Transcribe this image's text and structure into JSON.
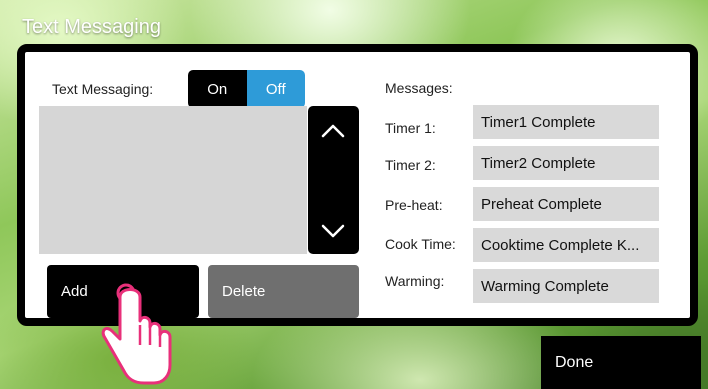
{
  "window": {
    "title": "Text Messaging"
  },
  "text_messaging": {
    "label": "Text Messaging:",
    "toggle": {
      "on_label": "On",
      "off_label": "Off",
      "selected": "Off"
    }
  },
  "list": {
    "items": [],
    "scroll_up_icon": "chevron-up-icon",
    "scroll_down_icon": "chevron-down-icon"
  },
  "buttons": {
    "add_label": "Add",
    "delete_label": "Delete",
    "done_label": "Done"
  },
  "messages": {
    "header": "Messages:",
    "rows": [
      {
        "label": "Timer 1:",
        "value": "Timer1 Complete"
      },
      {
        "label": "Timer 2:",
        "value": "Timer2 Complete"
      },
      {
        "label": "Pre-heat:",
        "value": "Preheat Complete"
      },
      {
        "label": "Cook Time:",
        "value": "Cooktime Complete K..."
      },
      {
        "label": "Warming:",
        "value": "Warming Complete"
      }
    ]
  },
  "colors": {
    "toggle_active": "#2e9bd8",
    "dialog_border": "#000000",
    "delete_button": "#6f6f6f"
  },
  "overlay": {
    "pointer_icon": "tap-hand-icon"
  }
}
